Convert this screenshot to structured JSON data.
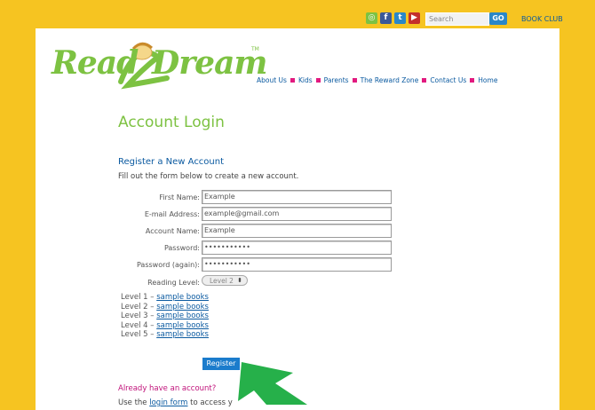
{
  "header": {
    "social_icons": [
      {
        "name": "rss-icon",
        "glyph": "◎",
        "color": "#7dc242"
      },
      {
        "name": "facebook-icon",
        "glyph": "f",
        "color": "#3b5998"
      },
      {
        "name": "twitter-icon",
        "glyph": "t",
        "color": "#2a87c8"
      },
      {
        "name": "youtube-icon",
        "glyph": "▶",
        "color": "#c4302b"
      }
    ],
    "search_placeholder": "Search",
    "go_label": "GO",
    "book_club_label": "BOOK CLUB"
  },
  "logo": {
    "word1": "Read",
    "word2": "Dream",
    "trademark": "TM"
  },
  "nav": {
    "items": [
      "About Us",
      "Kids",
      "Parents",
      "The Reward Zone",
      "Contact Us",
      "Home"
    ]
  },
  "main": {
    "title": "Account Login",
    "subtitle": "Register a New Account",
    "description": "Fill out the form below to create a new account."
  },
  "form": {
    "first_name_label": "First Name:",
    "first_name_value": "Example",
    "email_label": "E-mail Address:",
    "email_value": "example@gmail.com",
    "account_name_label": "Account Name:",
    "account_name_value": "Example",
    "password_label": "Password:",
    "password_value": "•••••••••••",
    "password_again_label": "Password (again):",
    "password_again_value": "•••••••••••",
    "reading_level_label": "Reading Level:",
    "reading_level_value": "Level 2"
  },
  "levels": [
    {
      "label": "Level 1 – ",
      "link": "sample books"
    },
    {
      "label": "Level 2 – ",
      "link": "sample books"
    },
    {
      "label": "Level 3 – ",
      "link": "sample books"
    },
    {
      "label": "Level 4 – ",
      "link": "sample books"
    },
    {
      "label": "Level 5 – ",
      "link": "sample books"
    }
  ],
  "register_label": "Register",
  "login_prompt": {
    "heading": "Already have an account?",
    "text_before": "Use the ",
    "link": "login form",
    "text_after": " to access y"
  },
  "colors": {
    "background": "#f6c421",
    "brand_green": "#7dc242",
    "link_blue": "#0b5aa0",
    "accent_pink": "#e2197f",
    "button_blue": "#1b7ccc",
    "arrow_green": "#26b04a"
  }
}
